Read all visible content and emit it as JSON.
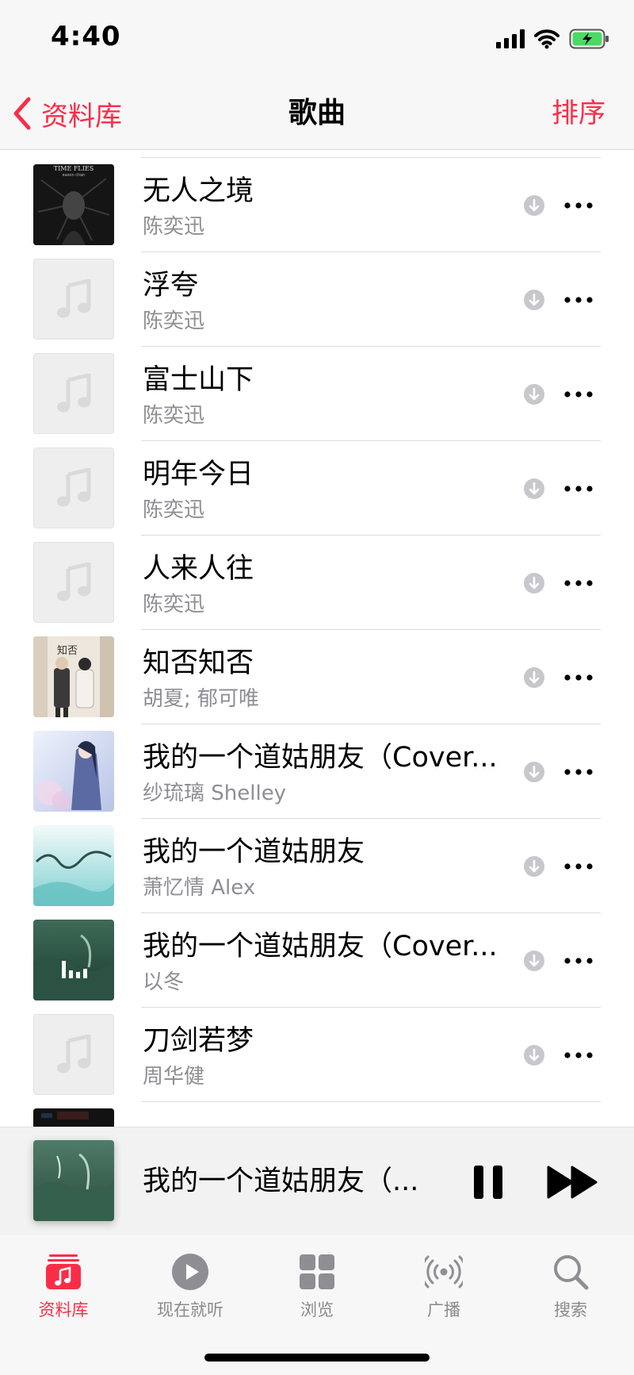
{
  "status_bar": {
    "time": "4:40"
  },
  "nav": {
    "back_label": "资料库",
    "title": "歌曲",
    "sort_label": "排序"
  },
  "songs": [
    {
      "title": "无人之境",
      "artist": "陈奕迅",
      "art": "time-flies"
    },
    {
      "title": "浮夸",
      "artist": "陈奕迅",
      "art": "placeholder"
    },
    {
      "title": "富士山下",
      "artist": "陈奕迅",
      "art": "placeholder"
    },
    {
      "title": "明年今日",
      "artist": "陈奕迅",
      "art": "placeholder"
    },
    {
      "title": "人来人往",
      "artist": "陈奕迅",
      "art": "placeholder"
    },
    {
      "title": "知否知否",
      "artist": "胡夏; 郁可唯",
      "art": "zhifou"
    },
    {
      "title": "我的一个道姑朋友（Cover...",
      "artist": "纱琉璃 Shelley",
      "art": "daogu-blue"
    },
    {
      "title": "我的一个道姑朋友",
      "artist": "萧忆情 Alex",
      "art": "daogu-teal"
    },
    {
      "title": "我的一个道姑朋友（Cover...",
      "artist": "以冬",
      "art": "daogu-green-playing"
    },
    {
      "title": "刀剑若梦",
      "artist": "周华健",
      "art": "placeholder"
    }
  ],
  "album_art": {
    "time_flies_line1": "TIME FLIES",
    "time_flies_line2": "eason chan"
  },
  "mini_player": {
    "title": "我的一个道姑朋友（..."
  },
  "tabs": [
    {
      "label": "资料库",
      "icon": "library-icon",
      "active": true
    },
    {
      "label": "现在就听",
      "icon": "play-circle-icon",
      "active": false
    },
    {
      "label": "浏览",
      "icon": "browse-grid-icon",
      "active": false
    },
    {
      "label": "广播",
      "icon": "radio-icon",
      "active": false
    },
    {
      "label": "搜索",
      "icon": "search-icon",
      "active": false
    }
  ],
  "colors": {
    "accent": "#fa2d48",
    "secondary_text": "#8e8e93",
    "battery": "#4cd964"
  }
}
